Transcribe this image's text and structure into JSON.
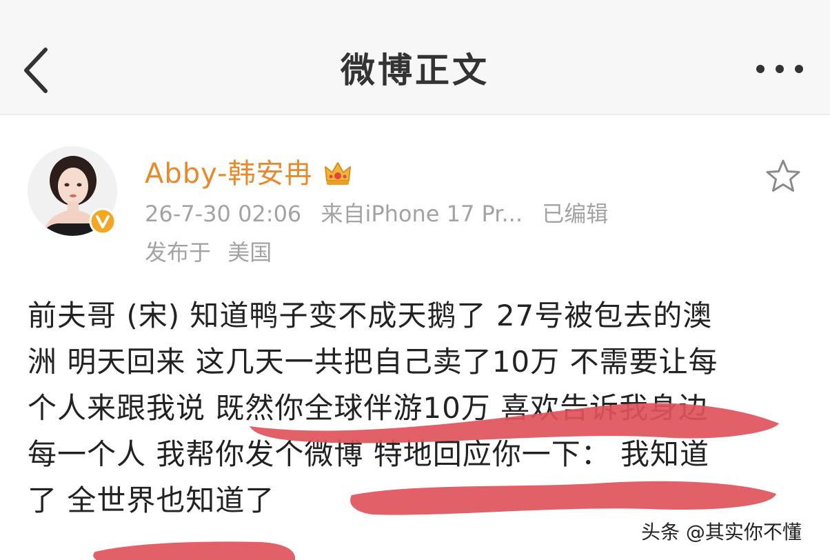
{
  "header": {
    "title": "微博正文",
    "back_icon": "chevron-left-icon",
    "more_icon": "more-horizontal-icon"
  },
  "post": {
    "author": {
      "name": "Abby-韩安冉",
      "avatar_icon": "avatar-photo",
      "verified_icon": "orange-v-badge-icon",
      "vip_icon": "crown-icon"
    },
    "meta": {
      "timestamp": "26-7-30 02:06",
      "source": "来自iPhone 17 Pr...",
      "edited": "已编辑",
      "published_prefix": "发布于",
      "location": "美国"
    },
    "favorite_icon": "star-outline-icon",
    "body_lines": [
      "前夫哥 (宋) 知道鸭子变不成天鹅了 27号被包去的澳",
      "洲 明天回来 这几天一共把自己卖了10万 不需要让每",
      "个人来跟我说 既然你全球伴游10万 喜欢告诉我身边",
      "每一个人 我帮你发个微博 特地回应你一下：  我知道",
      "了 全世界也知道了"
    ]
  },
  "watermark": "头条 @其实你不懂",
  "colors": {
    "username": "#e8892b",
    "meta": "#a3a3a3",
    "body_text": "#222222",
    "highlight_marks": "#e0545c",
    "header_bg": "#f7f7f7"
  }
}
